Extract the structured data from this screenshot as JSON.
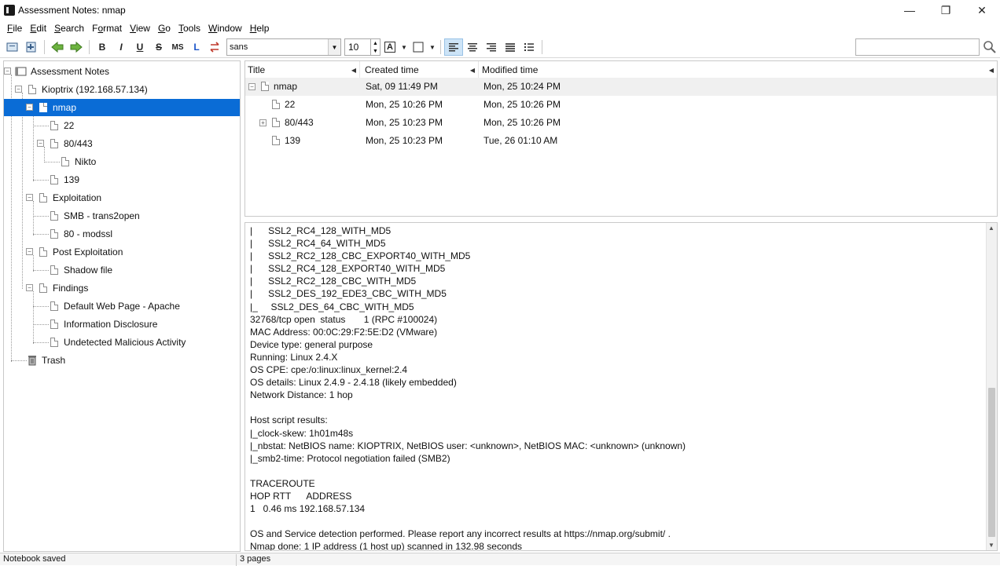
{
  "window": {
    "title": "Assessment Notes: nmap"
  },
  "menu": [
    {
      "pre": "",
      "ul": "F",
      "post": "ile"
    },
    {
      "pre": "",
      "ul": "E",
      "post": "dit"
    },
    {
      "pre": "",
      "ul": "S",
      "post": "earch"
    },
    {
      "pre": "F",
      "ul": "o",
      "post": "rmat"
    },
    {
      "pre": "",
      "ul": "V",
      "post": "iew"
    },
    {
      "pre": "",
      "ul": "G",
      "post": "o"
    },
    {
      "pre": "",
      "ul": "T",
      "post": "ools"
    },
    {
      "pre": "",
      "ul": "W",
      "post": "indow"
    },
    {
      "pre": "",
      "ul": "H",
      "post": "elp"
    }
  ],
  "toolbar": {
    "bold": "B",
    "italic": "I",
    "underline": "U",
    "strike": "S",
    "mono": "MS",
    "sub": "L",
    "font_name": "sans",
    "font_size": "10",
    "text_color_glyph": "A"
  },
  "tree": {
    "root": "Assessment Notes",
    "host": "Kioptrix (192.168.57.134)",
    "nmap": "nmap",
    "p22": "22",
    "p80": "80/443",
    "nikto": "Nikto",
    "p139": "139",
    "exploitation": "Exploitation",
    "smb": "SMB - trans2open",
    "modssl": "80 - modssl",
    "post": "Post Exploitation",
    "shadow": "Shadow file",
    "findings": "Findings",
    "default_page": "Default Web Page - Apache",
    "info_disc": "Information Disclosure",
    "malicious": "Undetected Malicious Activity",
    "trash": "Trash"
  },
  "list": {
    "headers": {
      "title": "Title",
      "created": "Created time",
      "modified": "Modified time"
    },
    "rows": [
      {
        "title": "nmap",
        "created": "Sat, 09 11:49 PM",
        "modified": "Mon, 25 10:24 PM"
      },
      {
        "title": "22",
        "created": "Mon, 25 10:26 PM",
        "modified": "Mon, 25 10:26 PM"
      },
      {
        "title": "80/443",
        "created": "Mon, 25 10:23 PM",
        "modified": "Mon, 25 10:26 PM"
      },
      {
        "title": "139",
        "created": "Mon, 25 10:23 PM",
        "modified": "Tue, 26 01:10 AM"
      }
    ]
  },
  "editor": {
    "lines": [
      "|      SSL2_RC4_128_WITH_MD5",
      "|      SSL2_RC4_64_WITH_MD5",
      "|      SSL2_RC2_128_CBC_EXPORT40_WITH_MD5",
      "|      SSL2_RC4_128_EXPORT40_WITH_MD5",
      "|      SSL2_RC2_128_CBC_WITH_MD5",
      "|      SSL2_DES_192_EDE3_CBC_WITH_MD5",
      "|_     SSL2_DES_64_CBC_WITH_MD5",
      "32768/tcp open  status       1 (RPC #100024)",
      "MAC Address: 00:0C:29:F2:5E:D2 (VMware)",
      "Device type: general purpose",
      "Running: Linux 2.4.X",
      "OS CPE: cpe:/o:linux:linux_kernel:2.4",
      "OS details: Linux 2.4.9 - 2.4.18 (likely embedded)",
      "Network Distance: 1 hop",
      "",
      "Host script results:",
      "|_clock-skew: 1h01m48s",
      "|_nbstat: NetBIOS name: KIOPTRIX, NetBIOS user: <unknown>, NetBIOS MAC: <unknown> (unknown)",
      "|_smb2-time: Protocol negotiation failed (SMB2)",
      "",
      "TRACEROUTE",
      "HOP RTT      ADDRESS",
      "1   0.46 ms 192.168.57.134",
      "",
      "OS and Service detection performed. Please report any incorrect results at https://nmap.org/submit/ .",
      "Nmap done: 1 IP address (1 host up) scanned in 132.98 seconds"
    ]
  },
  "status": {
    "left": "Notebook saved",
    "pages": "3 pages"
  }
}
